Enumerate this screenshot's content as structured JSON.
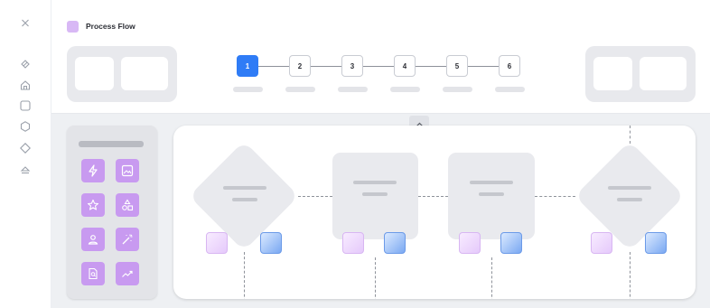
{
  "header": {
    "title": "Process Flow",
    "swatch_color": "#d8b8f5"
  },
  "sidebar": {
    "icons": [
      "close-icon",
      "tag-icon",
      "home-icon",
      "square-icon",
      "hexagon-icon",
      "diamond-icon",
      "eject-icon"
    ]
  },
  "stepper": {
    "steps": [
      "1",
      "2",
      "3",
      "4",
      "5",
      "6"
    ],
    "active_step": "1",
    "accent_color": "#2f7cf6"
  },
  "palette": {
    "tiles": [
      "lightning-icon",
      "image-icon",
      "star-icon",
      "shapes-icon",
      "user-icon",
      "magic-wand-icon",
      "document-icon",
      "trend-up-icon"
    ],
    "tile_color": "#c89af0"
  },
  "flow": {
    "nodes": [
      "diamond",
      "card",
      "card",
      "diamond"
    ],
    "chip_colors": {
      "purple": "#e5c9fb",
      "blue": "#7aa8f2"
    }
  }
}
